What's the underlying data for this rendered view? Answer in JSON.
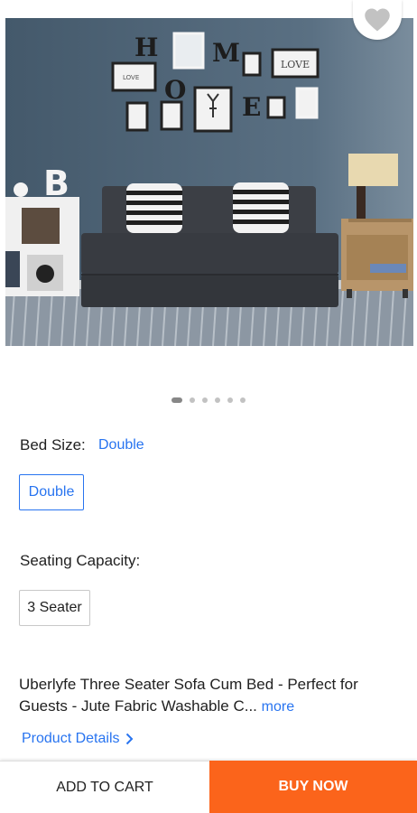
{
  "product": {
    "image_alt": "Dark grey sofa cum bed with striped cushions in a living room with HOME wall frames",
    "carousel": {
      "count": 6,
      "active_index": 0
    },
    "wall_letters": [
      "H",
      "O",
      "M",
      "E"
    ],
    "frame_text": {
      "love_small": "LOVE",
      "love_large": "LOVE"
    },
    "shelf_letter": "B"
  },
  "variants": {
    "bed_size_label": "Bed Size:",
    "bed_size_selected": "Double",
    "bed_size_options": [
      "Double"
    ],
    "seating_label": "Seating Capacity:",
    "seating_options": [
      "3 Seater"
    ]
  },
  "description": {
    "text": "Uberlyfe Three Seater Sofa Cum Bed - Perfect for Guests - Jute Fabric Washable C...",
    "more": "more"
  },
  "links": {
    "product_details": "Product Details"
  },
  "actions": {
    "add_to_cart": "ADD TO CART",
    "buy_now": "BUY NOW"
  },
  "colors": {
    "accent": "#2874f0",
    "buy_now": "#fb641b",
    "wall": "#4d6275",
    "sofa": "#3a3d42"
  }
}
